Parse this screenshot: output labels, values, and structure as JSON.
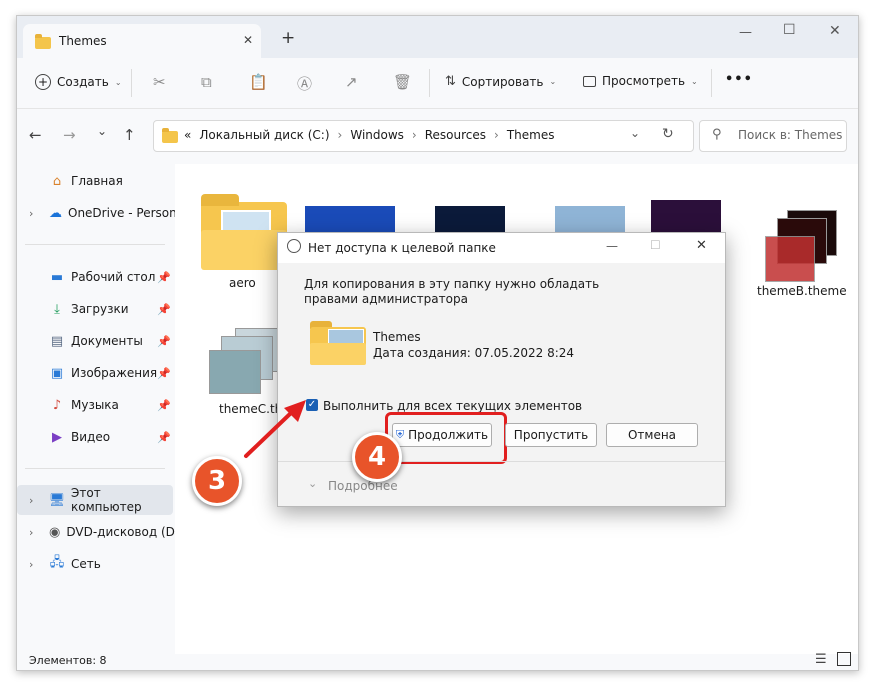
{
  "window": {
    "tab_title": "Themes",
    "tab_close": "✕",
    "new_tab": "+",
    "min": "—",
    "max": "☐",
    "close": "✕"
  },
  "toolbar": {
    "create": "Создать",
    "sort": "Сортировать",
    "view": "Просмотреть",
    "more": "•••"
  },
  "address": {
    "prefix": "«",
    "parts": [
      "Локальный диск (C:)",
      "Windows",
      "Resources",
      "Themes"
    ],
    "sep": "›",
    "search_placeholder": "Поиск в: Themes"
  },
  "sidebar": {
    "items": [
      {
        "label": "Главная",
        "icon": "home-icon"
      },
      {
        "label": "OneDrive - Persona",
        "icon": "onedrive-icon"
      },
      {
        "label": "Рабочий стол",
        "icon": "desktop-icon"
      },
      {
        "label": "Загрузки",
        "icon": "download-icon"
      },
      {
        "label": "Документы",
        "icon": "documents-icon"
      },
      {
        "label": "Изображения",
        "icon": "pictures-icon"
      },
      {
        "label": "Музыка",
        "icon": "music-icon"
      },
      {
        "label": "Видео",
        "icon": "video-icon"
      },
      {
        "label": "Этот компьютер",
        "icon": "computer-icon"
      },
      {
        "label": "DVD-дисковод (D:)",
        "icon": "dvd-icon"
      },
      {
        "label": "Сеть",
        "icon": "network-icon"
      }
    ]
  },
  "files": [
    {
      "name": "aero"
    },
    {
      "name": "themeB.theme"
    },
    {
      "name": "themeC.theme"
    }
  ],
  "status": {
    "count": "Элементов: 8"
  },
  "dialog": {
    "title": "Нет доступа к целевой папке",
    "message": "Для копирования в эту папку нужно обладать правами администратора",
    "item_name": "Themes",
    "item_date": "Дата создания: 07.05.2022 8:24",
    "checkbox_label": "Выполнить для всех текущих элементов",
    "continue": "Продолжить",
    "skip": "Пропустить",
    "cancel": "Отмена",
    "details": "Подробнее"
  },
  "annotations": {
    "step3": "3",
    "step4": "4",
    "color": "#e8542a"
  }
}
